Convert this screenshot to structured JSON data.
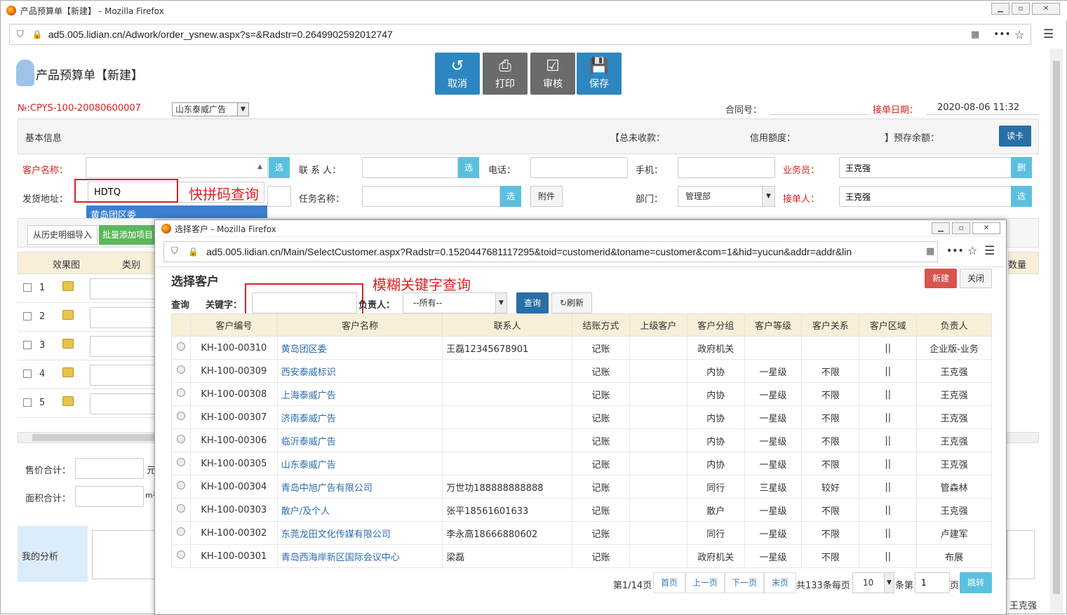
{
  "browser": {
    "title": "产品预算单【新建】 - Mozilla Firefox",
    "url": "ad5.005.lidian.cn/Adwork/order_ysnew.aspx?s=&Radstr=0.2649902592012747"
  },
  "page": {
    "title": "产品预算单【新建】",
    "order_no": "№:CPYS-100-20080600007",
    "company": "山东泰威广告",
    "contract_label": "合同号：",
    "order_date_label": "接单日期：",
    "order_date": "2020-08-06 11:32"
  },
  "toolbar": {
    "cancel": "取消",
    "print": "打印",
    "review": "审核",
    "save": "保存"
  },
  "basic": {
    "section": "基本信息",
    "total_unpaid": "【总未收款：",
    "credit": "信用额度：",
    "prepaid": "】预存余额：",
    "read_card": "读卡",
    "customer_label": "客户名称：",
    "contact_label": "联 系 人：",
    "phone_label": "电话：",
    "mobile_label": "手机：",
    "salesman_label": "业务员：",
    "salesman": "王克强",
    "del": "删",
    "ship_label": "发货地址：",
    "task_label": "任务名称：",
    "attach": "附件",
    "dept_label": "部门：",
    "dept": "管理部",
    "receiver_label": "接单人：",
    "receiver": "王克强",
    "select": "选"
  },
  "autocomplete": {
    "value": "HDTQ",
    "option": "黄岛团区委",
    "annotation": "快拼码查询"
  },
  "detail": {
    "import": "从历史明细导入",
    "batch": "批量添加项目",
    "col_effect": "效果图",
    "col_type": "类别",
    "col_qty": "数量",
    "rows": [
      "1",
      "2",
      "3",
      "4",
      "5"
    ]
  },
  "summary": {
    "price_total": "售价合计：",
    "price_unit": "元",
    "area_total": "面积合计：",
    "area_unit": "m²",
    "analysis": "我的分析",
    "bottom_name": "王克强"
  },
  "modal": {
    "title": "选择客户 - Mozilla Firefox",
    "url": "ad5.005.lidian.cn/Main/SelectCustomer.aspx?Radstr=0.1520447681117295&toid=customerid&toname=customer&com=1&hid=yucun&addr=addr&lin",
    "heading": "选择客户",
    "new": "新建",
    "close": "关闭",
    "query": "查询",
    "keyword_label": "关键字：",
    "owner_label": "负责人：",
    "owner_value": "--所有--",
    "search": "查询",
    "refresh": "刷新",
    "annotation": "模糊关键字查询",
    "columns": [
      "客户编号",
      "客户名称",
      "联系人",
      "结账方式",
      "上级客户",
      "客户分组",
      "客户等级",
      "客户关系",
      "客户区域",
      "负责人"
    ],
    "rows": [
      [
        "KH-100-00310",
        "黄岛团区委",
        "王磊12345678901",
        "记账",
        "",
        "政府机关",
        "",
        "",
        "||",
        "企业版-业务"
      ],
      [
        "KH-100-00309",
        "西安泰威标识",
        "",
        "记账",
        "",
        "内协",
        "一星级",
        "不限",
        "||",
        "王克强"
      ],
      [
        "KH-100-00308",
        "上海泰威广告",
        "",
        "记账",
        "",
        "内协",
        "一星级",
        "不限",
        "||",
        "王克强"
      ],
      [
        "KH-100-00307",
        "济南泰威广告",
        "",
        "记账",
        "",
        "内协",
        "一星级",
        "不限",
        "||",
        "王克强"
      ],
      [
        "KH-100-00306",
        "临沂泰威广告",
        "",
        "记账",
        "",
        "内协",
        "一星级",
        "不限",
        "||",
        "王克强"
      ],
      [
        "KH-100-00305",
        "山东泰威广告",
        "",
        "记账",
        "",
        "内协",
        "一星级",
        "不限",
        "||",
        "王克强"
      ],
      [
        "KH-100-00304",
        "青岛中旭广告有限公司",
        "万世功188888888888",
        "记账",
        "",
        "同行",
        "三星级",
        "较好",
        "||",
        "管森林"
      ],
      [
        "KH-100-00303",
        "散户/及个人",
        "张平18561601633",
        "记账",
        "",
        "散户",
        "一星级",
        "不限",
        "||",
        "王克强"
      ],
      [
        "KH-100-00302",
        "东莞龙田文化传媒有限公司",
        "李永高18666880602",
        "记账",
        "",
        "同行",
        "一星级",
        "不限",
        "||",
        "卢建军"
      ],
      [
        "KH-100-00301",
        "青岛西海岸新区国际会议中心",
        "梁磊",
        "记账",
        "",
        "政府机关",
        "一星级",
        "不限",
        "||",
        "布展"
      ]
    ],
    "pager": {
      "page_info": "第1/14页",
      "first": "首页",
      "prev": "上一页",
      "next": "下一页",
      "last": "末页",
      "total": "共133条每页",
      "per_page": "10",
      "tiao": "条第",
      "page_no": "1",
      "ye": "页",
      "jump": "跳转"
    }
  },
  "colors": {
    "toolbar_blue": "#2e86c1",
    "toolbar_gray": "#6b6b6b",
    "select_blue": "#5bc0de",
    "red": "#e02020",
    "new_red": "#d9534f"
  }
}
